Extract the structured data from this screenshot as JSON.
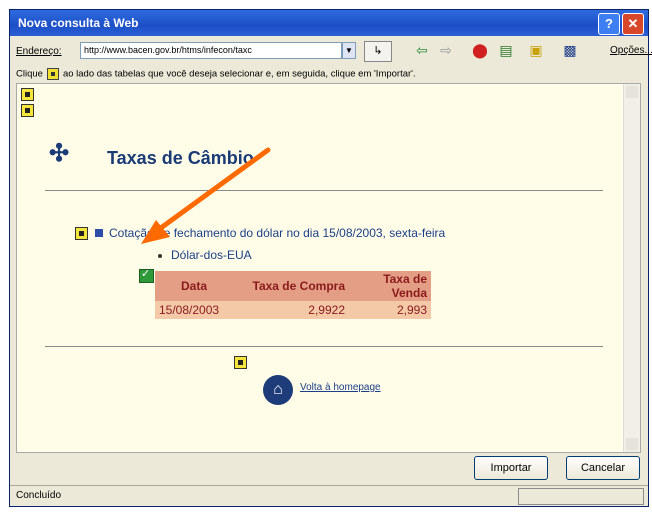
{
  "window": {
    "title": "Nova consulta à Web",
    "help_glyph": "?",
    "close_glyph": "✕"
  },
  "toolbar": {
    "address_label": "Endereço:",
    "address_value": "http://www.bacen.gov.br/htms/infecon/taxc",
    "go_label": "↳",
    "options_label": "Opções..."
  },
  "hint": {
    "text_before": "Clique",
    "text_after": "ao lado das tabelas que você deseja selecionar e, em seguida, clique em 'Importar'."
  },
  "page": {
    "title": "Taxas de Câmbio",
    "caption": "Cotação de fechamento do dólar no dia 15/08/2003, sexta-feira",
    "currency": "Dólar-dos-EUA",
    "table": {
      "headers": [
        "Data",
        "Taxa de Compra",
        "Taxa de Venda"
      ],
      "rows": [
        [
          "15/08/2003",
          "2,9922",
          "2,993"
        ]
      ]
    },
    "home_link": "Volta à homepage"
  },
  "buttons": {
    "import": "Importar",
    "cancel": "Cancelar"
  },
  "status": {
    "text": "Concluído"
  },
  "colors": {
    "arrow": "#ff6a00",
    "table_header": "#e39e85",
    "table_cell": "#f3c9a8",
    "title_bar": "#2f6bdf"
  }
}
